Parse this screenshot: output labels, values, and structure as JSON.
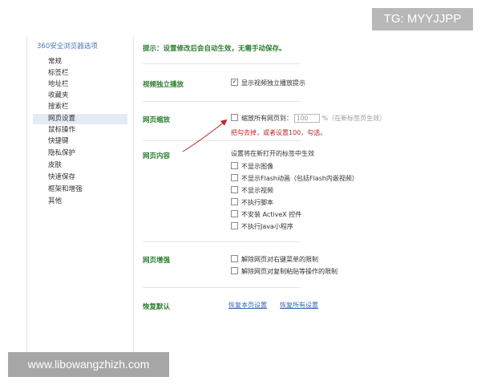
{
  "sidebar": {
    "title": "360安全浏览器选项",
    "items": [
      {
        "label": "常规",
        "active": false
      },
      {
        "label": "标签栏",
        "active": false
      },
      {
        "label": "地址栏",
        "active": false
      },
      {
        "label": "收藏夹",
        "active": false
      },
      {
        "label": "搜索栏",
        "active": false
      },
      {
        "label": "网页设置",
        "active": true
      },
      {
        "label": "鼠标操作",
        "active": false
      },
      {
        "label": "快捷键",
        "active": false
      },
      {
        "label": "隐私保护",
        "active": false
      },
      {
        "label": "皮肤",
        "active": false
      },
      {
        "label": "快速保存",
        "active": false
      },
      {
        "label": "框架和增强",
        "active": false
      },
      {
        "label": "其他",
        "active": false
      }
    ]
  },
  "main": {
    "tip": "提示：设置修改后会自动生效，无需手动保存。",
    "video": {
      "label": "视频独立播放",
      "option": "显示视频独立播放提示",
      "checked": true
    },
    "zoom": {
      "label": "网页缩放",
      "option": "缩放所有网页到：",
      "value": "100",
      "unit": "%（在新标签页生效）",
      "warning": "把勾去掉，或者设置100，勾选。",
      "checked": false
    },
    "content": {
      "label": "网页内容",
      "note": "设置将在新打开的标签中生效",
      "options": [
        {
          "label": "不显示图像",
          "checked": false
        },
        {
          "label": "不显示Flash动画（包括Flash内嵌视频）",
          "checked": false
        },
        {
          "label": "不显示视频",
          "checked": false
        },
        {
          "label": "不执行脚本",
          "checked": false
        },
        {
          "label": "不安装 ActiveX 控件",
          "checked": false
        },
        {
          "label": "不执行Java小程序",
          "checked": false
        }
      ]
    },
    "enhance": {
      "label": "网页增强",
      "options": [
        {
          "label": "解除网页对右键菜单的限制",
          "checked": false
        },
        {
          "label": "解除网页对复制粘贴等操作的限制",
          "checked": false
        }
      ]
    },
    "restore": {
      "label": "恢复默认",
      "restore_page": "恢复本页设置",
      "restore_all": "恢复所有设置"
    }
  },
  "overlays": {
    "tg_badge": "TG: MYYJJPP",
    "watermark": "www.libowangzhizh.com"
  },
  "colors": {
    "section_label": "#2e7d32",
    "link": "#3a67b0",
    "warning": "#c0282d",
    "active_item_bg": "#e4ebf5",
    "annotation_arrow": "#c0282d"
  }
}
